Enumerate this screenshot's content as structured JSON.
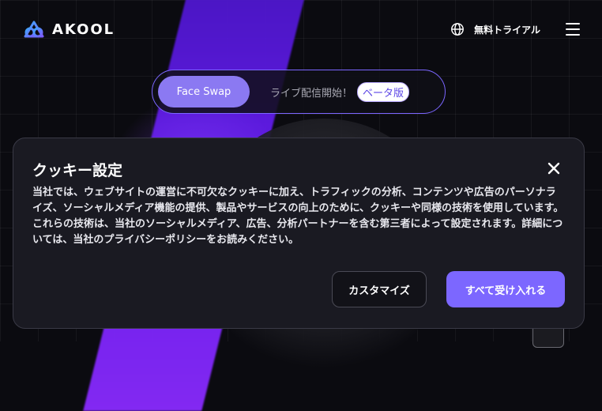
{
  "header": {
    "logo_text": "AKOOL",
    "trial_label": "無料トライアル",
    "icons": {
      "globe": "globe-icon",
      "menu": "menu-icon"
    }
  },
  "switcher": {
    "active_label": "Face Swap",
    "live_label": "ライブ配信開始！",
    "beta_label": "ベータ版"
  },
  "cookie": {
    "title": "クッキー設定",
    "body": "当社では、ウェブサイトの運営に不可欠なクッキーに加え、トラフィックの分析、コンテンツや広告のパーソナライズ、ソーシャルメディア機能の提供、製品やサービスの向上のために、クッキーや同様の技術を使用しています。これらの技術は、当社のソーシャルメディア、広告、分析パートナーを含む第三者によって設定されます。詳細については、当社のプライバシーポリシーをお読みください。",
    "customize_label": "カスタマイズ",
    "accept_label": "すべて受け入れる"
  },
  "colors": {
    "accent": "#7c67ff",
    "pill_active": "#8b79f2",
    "background": "#0b0b10",
    "dialog_bg": "#1a1a22"
  }
}
